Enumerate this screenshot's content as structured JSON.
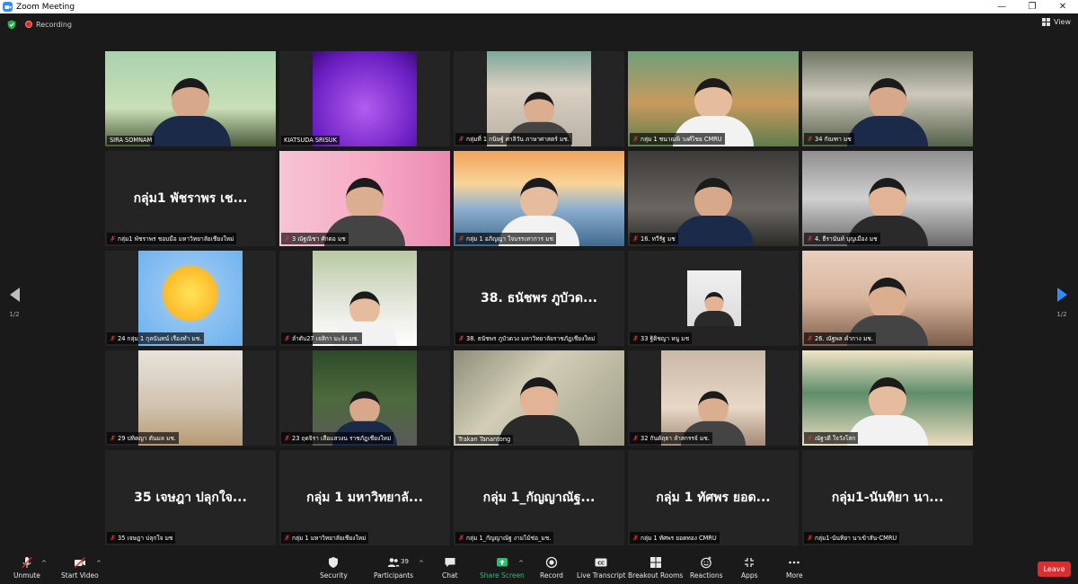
{
  "window": {
    "title": "Zoom Meeting",
    "minimize": "—",
    "maximize": "❐",
    "close": "✕"
  },
  "status": {
    "recording": "Recording",
    "view": "View"
  },
  "pager": {
    "left_page": "1/2",
    "right_page": "1/2"
  },
  "tiles": [
    {
      "label": "SIRA SOMNAM",
      "muted": false,
      "video": "v-room",
      "big": ""
    },
    {
      "label": "KIATSUDA SRISUK",
      "muted": false,
      "video": "v-purple",
      "big": "",
      "center": true
    },
    {
      "label": "กลุ่มที่ 1 กนิษฐ์ ศาลิวัน ภาษาศาสตร์ มช.",
      "muted": true,
      "video": "v-street",
      "big": "",
      "center": true
    },
    {
      "label": "กลุ่ม 1 ชนาณพิ วงศ์ไชย CMRU",
      "muted": true,
      "video": "v-cartoon",
      "big": ""
    },
    {
      "label": "34 กัณฑา มช",
      "muted": true,
      "video": "v-school",
      "big": ""
    },
    {
      "label": "กลุ่ม1 พัชราพร ชอบมือ มหาวิทยาลัยเชียงใหม่",
      "muted": true,
      "video": "",
      "big": "กลุ่ม1 พัชราพร เช..."
    },
    {
      "label": "3 ณัฐณิชา ศักดอ มช",
      "muted": true,
      "video": "v-pink",
      "big": ""
    },
    {
      "label": "กลุ่ม 1 อภิญญา ใจบรรเทาการ มช",
      "muted": true,
      "video": "v-bridge",
      "big": ""
    },
    {
      "label": "16. ทวีรัฐ มช",
      "muted": true,
      "video": "v-dark",
      "big": ""
    },
    {
      "label": "4. ธีรานันท์ บุญเมือง มช",
      "muted": true,
      "video": "v-portrait",
      "big": ""
    },
    {
      "label": "24 กลุ่ม 1 กุลนันทน์ เรืองทำ มช.",
      "muted": true,
      "video": "v-sun",
      "big": "",
      "center": true
    },
    {
      "label": "ลำดับ27 เจสิกา มะจ้ง มช.",
      "muted": true,
      "video": "v-girl",
      "big": "",
      "center": true
    },
    {
      "label": "38. ธนัชพร ภูบัวดวง มหาวิทยาลัยราชภัฏเชียงใหม่",
      "muted": true,
      "video": "",
      "big": "38. ธนัชพร ภูบัวด..."
    },
    {
      "label": "33 ฐิติชญา หนู มช",
      "muted": true,
      "video": "v-id",
      "big": "",
      "small": true
    },
    {
      "label": "26. ณัฐพล คำกาง มช.",
      "muted": true,
      "video": "v-room2",
      "big": ""
    },
    {
      "label": "29 ปทิตญา ตันมล มช.",
      "muted": true,
      "video": "v-hands",
      "big": "",
      "center": true
    },
    {
      "label": "23 ฤดจิรา เสือแสวงน ราชภัฏเชียงใหม่",
      "muted": true,
      "video": "v-bench",
      "big": "",
      "center": true
    },
    {
      "label": "Trakan Tanantong",
      "muted": false,
      "video": "v-man",
      "big": "",
      "speaking": true
    },
    {
      "label": "32 กันต์ฤธา ลำสกรรจ์ มช.",
      "muted": true,
      "video": "v-girl2",
      "big": "",
      "center": true
    },
    {
      "label": "ณัฐวดี ใจวังโสก",
      "muted": true,
      "video": "v-class",
      "big": ""
    },
    {
      "label": "35 เจษฎา ปลุกใจ มช",
      "muted": true,
      "video": "",
      "big": "35 เจษฎา ปลุกใจ..."
    },
    {
      "label": "กลุ่ม 1 มหาวิทยาลัยเชียงใหม่",
      "muted": true,
      "video": "",
      "big": "กลุ่ม 1 มหาวิทยาลั..."
    },
    {
      "label": "กลุ่ม 1_กัญญาณัฐ งามไม้ช่อ_มช.",
      "muted": true,
      "video": "",
      "big": "กลุ่ม 1_กัญญาณัฐ..."
    },
    {
      "label": "กลุ่ม 1 ทัศพร ยอดทอง CMRU",
      "muted": true,
      "video": "",
      "big": "กลุ่ม 1 ทัศพร ยอด..."
    },
    {
      "label": "กลุ่ม1-นันทิยา นาเข้าสัน-CMRU",
      "muted": true,
      "video": "",
      "big": "กลุ่ม1-นันทิยา นา..."
    }
  ],
  "toolbar": {
    "unmute": "Unmute",
    "start_video": "Start Video",
    "security": "Security",
    "participants": "Participants",
    "participants_count": "39",
    "chat": "Chat",
    "share_screen": "Share Screen",
    "record": "Record",
    "live_transcript": "Live Transcript",
    "breakout_rooms": "Breakout Rooms",
    "reactions": "Reactions",
    "apps": "Apps",
    "more": "More",
    "leave": "Leave",
    "cc_glyph": "CC",
    "caret": "^"
  },
  "colors": {
    "accent": "#2d8cff",
    "share": "#25c16f",
    "leave": "#dc2e2e",
    "speaker": "#c8e47a",
    "recording": "#e02828"
  }
}
